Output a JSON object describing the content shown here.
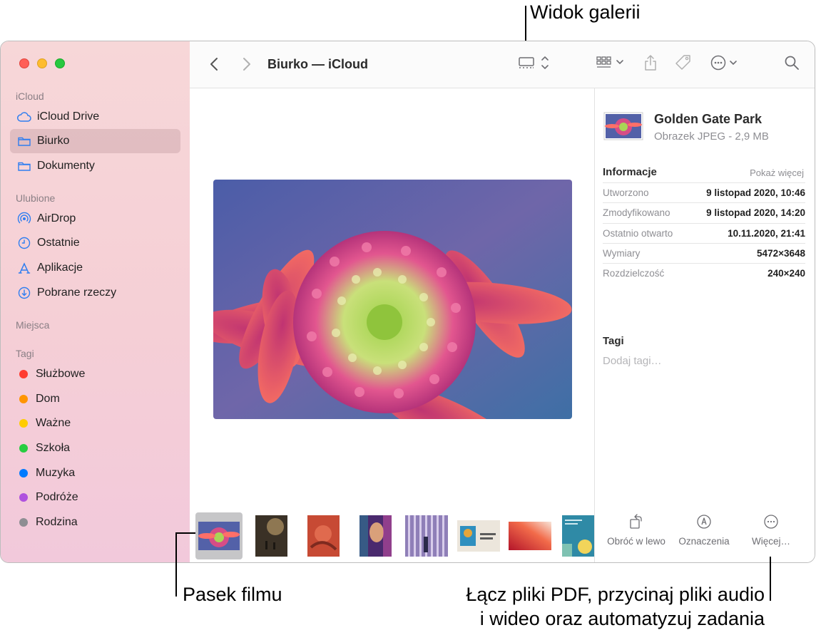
{
  "callouts": {
    "gallery_view": "Widok galerii",
    "filmstrip": "Pasek filmu",
    "more_line1": "Łącz pliki PDF, przycinaj pliki audio",
    "more_line2": "i wideo oraz automatyzuj zadania"
  },
  "sidebar": {
    "sections": {
      "icloud": "iCloud",
      "favorites": "Ulubione",
      "locations": "Miejsca",
      "tags": "Tagi"
    },
    "icloud_items": [
      {
        "label": "iCloud Drive",
        "icon": "cloud-icon"
      },
      {
        "label": "Biurko",
        "icon": "folder-icon",
        "selected": true
      },
      {
        "label": "Dokumenty",
        "icon": "folder-icon"
      }
    ],
    "favorite_items": [
      {
        "label": "AirDrop",
        "icon": "airdrop-icon"
      },
      {
        "label": "Ostatnie",
        "icon": "clock-icon"
      },
      {
        "label": "Aplikacje",
        "icon": "applications-icon"
      },
      {
        "label": "Pobrane rzeczy",
        "icon": "download-icon"
      }
    ],
    "tag_items": [
      {
        "label": "Służbowe",
        "color": "#ff3b30"
      },
      {
        "label": "Dom",
        "color": "#ff9500"
      },
      {
        "label": "Ważne",
        "color": "#ffcc00"
      },
      {
        "label": "Szkoła",
        "color": "#28cd41"
      },
      {
        "label": "Muzyka",
        "color": "#007aff"
      },
      {
        "label": "Podróże",
        "color": "#af52de"
      },
      {
        "label": "Rodzina",
        "color": "#8e8e93"
      }
    ]
  },
  "toolbar": {
    "title": "Biurko — iCloud"
  },
  "inspector": {
    "name": "Golden Gate Park",
    "kind": "Obrazek JPEG - 2,9 MB",
    "info_heading": "Informacje",
    "show_more": "Pokaż więcej",
    "rows": [
      {
        "key": "Utworzono",
        "value": "9 listopad 2020, 10:46"
      },
      {
        "key": "Zmodyfikowano",
        "value": "9 listopad 2020, 14:20"
      },
      {
        "key": "Ostatnio otwarto",
        "value": "10.11.2020, 21:41"
      },
      {
        "key": "Wymiary",
        "value": "5472×3648"
      },
      {
        "key": "Rozdzielczość",
        "value": "240×240"
      }
    ],
    "tags_heading": "Tagi",
    "tags_placeholder": "Dodaj tagi…",
    "actions": {
      "rotate": "Obróć w lewo",
      "markup": "Oznaczenia",
      "more": "Więcej…"
    }
  },
  "colors": {
    "accent": "#1a73e8",
    "sidebar_bg": "#f6d4d8"
  }
}
